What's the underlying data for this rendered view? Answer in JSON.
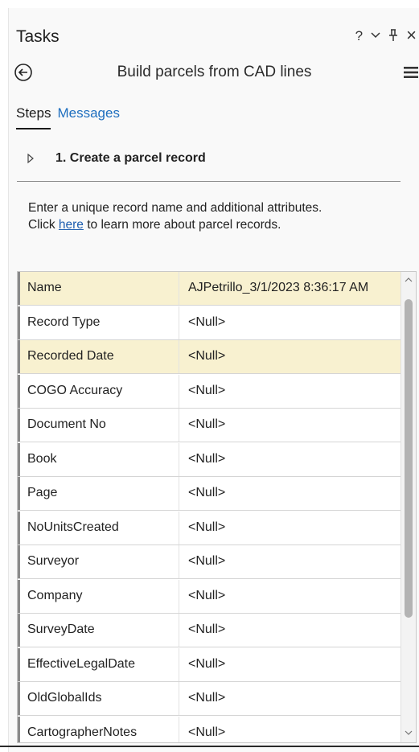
{
  "window": {
    "title": "Tasks",
    "help_icon": "question-icon",
    "menu_icon": "chevron-down-icon",
    "pin_icon": "pin-icon",
    "close_icon": "close-icon",
    "help_glyph": "?",
    "close_glyph": "×"
  },
  "task": {
    "title": "Build parcels from CAD lines",
    "back_icon": "back-arrow-icon",
    "menu_icon": "hamburger-icon"
  },
  "tabs": [
    {
      "label": "Steps",
      "active": true
    },
    {
      "label": "Messages",
      "active": false
    }
  ],
  "step": {
    "label": "1.  Create a parcel record",
    "expand_icon": "triangle-right-icon"
  },
  "instructions": {
    "line1": "Enter a unique record name and additional attributes.",
    "before_link": "Click ",
    "link": "here",
    "after_link": " to learn more about parcel records."
  },
  "attributes": [
    {
      "name": "Name",
      "value": "AJPetrillo_3/1/2023 8:36:17 AM",
      "highlight": true
    },
    {
      "name": "Record Type",
      "value": "<Null>",
      "highlight": false
    },
    {
      "name": "Recorded Date",
      "value": "<Null>",
      "highlight": true
    },
    {
      "name": "COGO Accuracy",
      "value": "<Null>",
      "highlight": false
    },
    {
      "name": "Document No",
      "value": "<Null>",
      "highlight": false
    },
    {
      "name": "Book",
      "value": "<Null>",
      "highlight": false
    },
    {
      "name": "Page",
      "value": "<Null>",
      "highlight": false
    },
    {
      "name": "NoUnitsCreated",
      "value": "<Null>",
      "highlight": false
    },
    {
      "name": "Surveyor",
      "value": "<Null>",
      "highlight": false
    },
    {
      "name": "Company",
      "value": "<Null>",
      "highlight": false
    },
    {
      "name": "SurveyDate",
      "value": "<Null>",
      "highlight": false
    },
    {
      "name": "EffectiveLegalDate",
      "value": "<Null>",
      "highlight": false
    },
    {
      "name": "OldGlobalIds",
      "value": "<Null>",
      "highlight": false
    },
    {
      "name": "CartographerNotes",
      "value": "<Null>",
      "highlight": false
    }
  ],
  "colors": {
    "highlight_row": "#f8f1d0",
    "link": "#1f6fbf",
    "pane_bg": "#f9f9f9"
  }
}
